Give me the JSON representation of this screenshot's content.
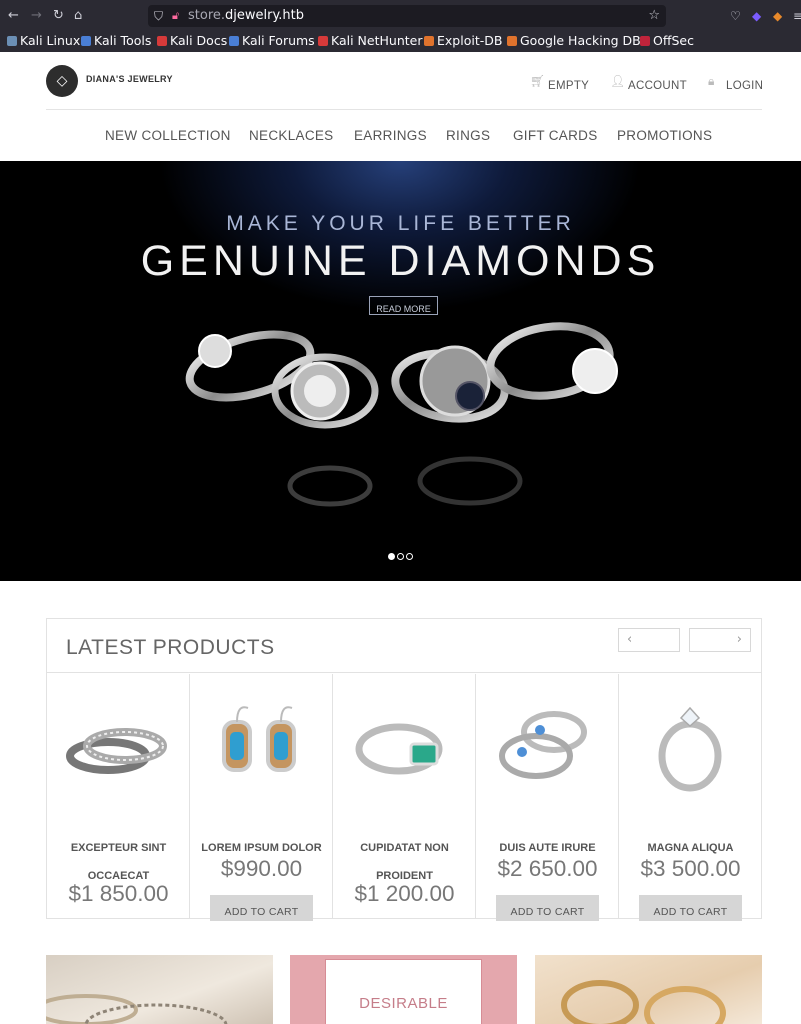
{
  "browser": {
    "url_prefix": "store.",
    "url_domain": "djewelry.htb",
    "bookmarks": [
      {
        "label": "Kali Linux",
        "color": "#6b8fb5"
      },
      {
        "label": "Kali Tools",
        "color": "#4a7fd6"
      },
      {
        "label": "Kali Docs",
        "color": "#d63a3a"
      },
      {
        "label": "Kali Forums",
        "color": "#4a7fd6"
      },
      {
        "label": "Kali NetHunter",
        "color": "#d63a3a"
      },
      {
        "label": "Exploit-DB",
        "color": "#e0732d"
      },
      {
        "label": "Google Hacking DB",
        "color": "#e0732d"
      },
      {
        "label": "OffSec",
        "color": "#c0243b"
      }
    ]
  },
  "header": {
    "brand": "DIANA'S JEWELRY",
    "cart_label": "EMPTY",
    "account_label": "ACCOUNT",
    "login_label": "LOGIN"
  },
  "nav": {
    "items": [
      "NEW COLLECTION",
      "NECKLACES",
      "EARRINGS",
      "RINGS",
      "GIFT CARDS",
      "PROMOTIONS"
    ]
  },
  "hero": {
    "subtitle": "MAKE YOUR LIFE BETTER",
    "title": "GENUINE DIAMONDS",
    "button_label": "READ MORE",
    "slide_count": 3,
    "active_slide": 1
  },
  "products": {
    "title": "LATEST PRODUCTS",
    "prev_icon": "chevron-left-icon",
    "next_icon": "chevron-right-icon",
    "items": [
      {
        "name": "EXCEPTEUR SINT OCCAECAT",
        "price": "$1 850.00",
        "button": "",
        "image": "stacked-rings"
      },
      {
        "name": "LOREM IPSUM DOLOR",
        "price": "$990.00",
        "button": "ADD TO CART",
        "image": "blue-earrings"
      },
      {
        "name": "CUPIDATAT NON PROIDENT",
        "price": "$1 200.00",
        "button": "ADD TO CART",
        "image": "emerald-ring"
      },
      {
        "name": "DUIS AUTE IRURE",
        "price": "$2 650.00",
        "button": "ADD TO CART",
        "image": "blue-stone-rings"
      },
      {
        "name": "MAGNA ALIQUA",
        "price": "$3 500.00",
        "button": "ADD TO CART",
        "image": "solitaire-ring"
      }
    ]
  },
  "promos": {
    "middle_label": "DESIRABLE"
  }
}
